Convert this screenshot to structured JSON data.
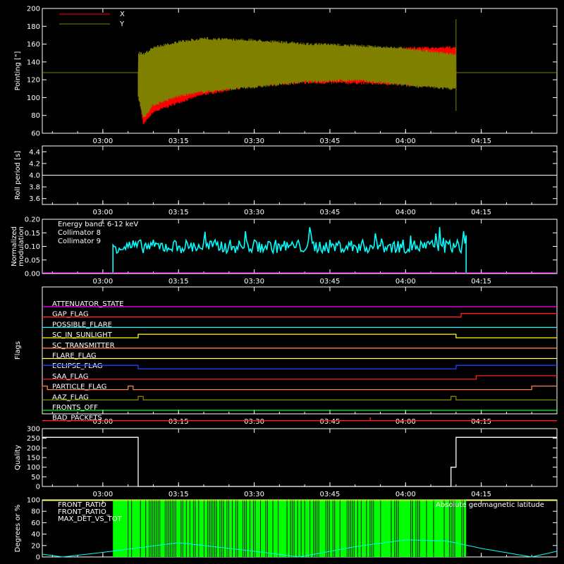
{
  "chart_data": [
    {
      "type": "line",
      "panel": "pointing",
      "ylabel": "Pointing [\"]",
      "ylim": [
        60,
        200
      ],
      "yticks": [
        60,
        80,
        100,
        120,
        140,
        160,
        180,
        200
      ],
      "xlim": [
        "02:48",
        "04:30"
      ],
      "xticks": [
        "03:00",
        "03:15",
        "03:30",
        "03:45",
        "04:00",
        "04:15"
      ],
      "legend_position": "top-left",
      "series": [
        {
          "name": "X",
          "color": "#ff0000",
          "envelope_x": [
            "02:48",
            "03:07",
            "03:08",
            "03:10",
            "03:15",
            "03:20",
            "03:30",
            "03:40",
            "03:50",
            "04:00",
            "04:10"
          ],
          "envelope_high": [
            128,
            150,
            128,
            130,
            133,
            137,
            145,
            151,
            155,
            157,
            158
          ],
          "envelope_low": [
            128,
            105,
            68,
            82,
            93,
            102,
            112,
            115,
            115,
            113,
            110
          ],
          "flat_before": 128,
          "flat_after": 128
        },
        {
          "name": "Y",
          "color": "#808000",
          "envelope_x": [
            "02:48",
            "03:07",
            "03:08",
            "03:10",
            "03:15",
            "03:20",
            "03:30",
            "03:40",
            "03:50",
            "04:00",
            "04:10"
          ],
          "envelope_high": [
            128,
            152,
            150,
            158,
            164,
            168,
            166,
            162,
            160,
            157,
            150
          ],
          "envelope_low": [
            128,
            100,
            75,
            90,
            100,
            105,
            110,
            116,
            118,
            112,
            108
          ],
          "flat_before": 128,
          "flat_after": 128
        }
      ]
    },
    {
      "type": "line",
      "panel": "roll",
      "ylabel": "Roll period [s]",
      "ylim": [
        3.5,
        4.5
      ],
      "yticks": [
        3.6,
        3.8,
        4.0,
        4.2,
        4.4
      ],
      "xlim": [
        "02:48",
        "04:30"
      ],
      "xticks": [
        "03:00",
        "03:15",
        "03:30",
        "03:45",
        "04:00",
        "04:15"
      ],
      "series": [
        {
          "name": "",
          "color": "#ffffff",
          "x": [
            "02:48",
            "04:30"
          ],
          "values": [
            4.0,
            4.0
          ]
        }
      ]
    },
    {
      "type": "line",
      "panel": "modulation",
      "ylabel": "Normalized modulation",
      "ylim": [
        0.0,
        0.2
      ],
      "yticks": [
        0.0,
        0.05,
        0.1,
        0.15,
        0.2
      ],
      "xlim": [
        "02:48",
        "04:30"
      ],
      "xticks": [
        "03:00",
        "03:15",
        "03:30",
        "03:45",
        "04:00",
        "04:15"
      ],
      "annotation": "Energy band: 6-12 keV",
      "series": [
        {
          "name": "Collimator 8",
          "color": "#00ffff",
          "active_from": "03:02",
          "active_to": "04:12",
          "mean": 0.1,
          "spread": 0.025
        },
        {
          "name": "Collimator 9",
          "color": "#ff00ff",
          "x": [
            "02:48",
            "04:30"
          ],
          "values": [
            0.0,
            0.0
          ]
        }
      ]
    },
    {
      "type": "line",
      "panel": "flags",
      "ylabel": "Flags",
      "xlim": [
        "02:48",
        "04:30"
      ],
      "xticks": [
        "03:00",
        "03:15",
        "03:30",
        "03:45",
        "04:00",
        "04:15"
      ],
      "series": [
        {
          "name": "ATTENUATOR_STATE",
          "color": "#ff00ff",
          "steps": [
            [
              "02:48",
              0
            ]
          ]
        },
        {
          "name": "GAP_FLAG",
          "color": "#ff2020",
          "steps": [
            [
              "02:48",
              0
            ],
            [
              "04:11",
              1
            ]
          ]
        },
        {
          "name": "POSSIBLE_FLARE",
          "color": "#00ffff",
          "steps": [
            [
              "02:48",
              0
            ]
          ]
        },
        {
          "name": "SC_IN_SUNLIGHT",
          "color": "#ffff00",
          "steps": [
            [
              "02:48",
              0
            ],
            [
              "03:07",
              1
            ],
            [
              "04:10",
              0
            ]
          ]
        },
        {
          "name": "SC_TRANSMITTER",
          "color": "#ff8040",
          "steps": [
            [
              "02:48",
              0
            ]
          ]
        },
        {
          "name": "FLARE_FLAG",
          "color": "#ffff60",
          "steps": [
            [
              "02:48",
              0
            ]
          ]
        },
        {
          "name": "ECLIPSE_FLAG",
          "color": "#2040ff",
          "steps": [
            [
              "02:48",
              1
            ],
            [
              "03:07",
              0
            ],
            [
              "04:10",
              1
            ]
          ]
        },
        {
          "name": "SAA_FLAG",
          "color": "#ff2020",
          "steps": [
            [
              "02:48",
              0
            ],
            [
              "04:14",
              1
            ]
          ]
        },
        {
          "name": "PARTICLE_FLAG",
          "color": "#ff8040",
          "steps": [
            [
              "02:48",
              0
            ],
            [
              "02:48",
              1
            ],
            [
              "02:49",
              0
            ],
            [
              "03:05",
              1
            ],
            [
              "03:06",
              0
            ],
            [
              "04:25",
              1
            ]
          ]
        },
        {
          "name": "AAZ_FLAG",
          "color": "#808000",
          "steps": [
            [
              "02:48",
              0
            ],
            [
              "03:07",
              1
            ],
            [
              "03:08",
              0
            ],
            [
              "04:09",
              1
            ],
            [
              "04:10",
              0
            ]
          ]
        },
        {
          "name": "FRONTS_OFF",
          "color": "#00ff00",
          "steps": [
            [
              "02:48",
              0
            ]
          ]
        },
        {
          "name": "BAD_PACKETS",
          "color": "#ff2020",
          "steps": [
            [
              "02:48",
              0
            ],
            [
              "03:53",
              1
            ],
            [
              "03:53",
              0
            ]
          ]
        }
      ]
    },
    {
      "type": "line",
      "panel": "quality",
      "ylabel": "Quality",
      "ylim": [
        0,
        300
      ],
      "yticks": [
        0,
        50,
        100,
        150,
        200,
        250,
        300
      ],
      "xlim": [
        "02:48",
        "04:30"
      ],
      "xticks": [
        "03:00",
        "03:15",
        "03:30",
        "03:45",
        "04:00",
        "04:15"
      ],
      "series": [
        {
          "name": "",
          "color": "#ffffff",
          "x": [
            "02:48",
            "03:07",
            "03:07",
            "04:09",
            "04:09",
            "04:10",
            "04:10",
            "04:30"
          ],
          "values": [
            255,
            255,
            0,
            0,
            100,
            100,
            255,
            255
          ]
        }
      ]
    },
    {
      "type": "area",
      "panel": "ratios",
      "ylabel": "Degrees or %",
      "ylim": [
        0,
        100
      ],
      "yticks": [
        0,
        20,
        40,
        60,
        80,
        100
      ],
      "xlim": [
        "02:48",
        "04:30"
      ],
      "xticks": [
        "03:00",
        "03:15",
        "03:30",
        "03:45",
        "04:00",
        "04:15"
      ],
      "series": [
        {
          "name": "FRONT_RATIO",
          "color": "#ffff00"
        },
        {
          "name": "FRONT_RATIO_",
          "color": "#00ff00",
          "active_from": "03:02",
          "active_to": "04:12",
          "level": 100
        },
        {
          "name": "MAX_DET_VS_TOT",
          "color": "#ff8040"
        },
        {
          "name": "Absolute geomagnetic latitude",
          "color": "#00ffff",
          "x": [
            "02:48",
            "02:52",
            "03:00",
            "03:15",
            "03:30",
            "03:39",
            "03:50",
            "04:00",
            "04:08",
            "04:15",
            "04:25",
            "04:30"
          ],
          "values": [
            5,
            0,
            8,
            25,
            10,
            0,
            18,
            30,
            28,
            15,
            0,
            10
          ]
        }
      ]
    }
  ]
}
